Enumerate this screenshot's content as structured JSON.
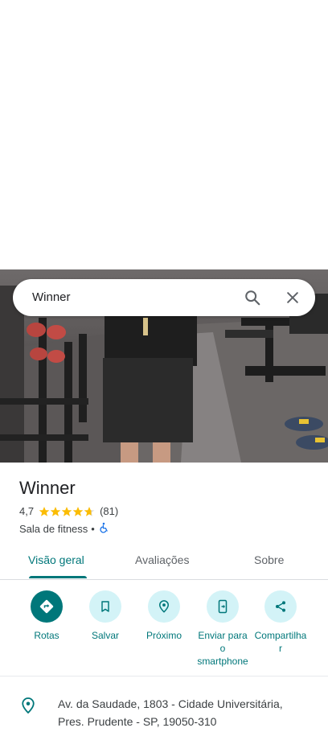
{
  "search": {
    "query": "Winner"
  },
  "place": {
    "title": "Winner",
    "rating": "4,7",
    "stars": 4.7,
    "reviews_count": "(81)",
    "category": "Sala de fitness",
    "separator": "•",
    "accessibility_icon": "wheelchair-icon"
  },
  "tabs": [
    {
      "label": "Visão geral",
      "active": true
    },
    {
      "label": "Avaliações",
      "active": false
    },
    {
      "label": "Sobre",
      "active": false
    }
  ],
  "actions": [
    {
      "label": "Rotas",
      "icon": "directions-icon"
    },
    {
      "label": "Salvar",
      "icon": "bookmark-icon"
    },
    {
      "label": "Próximo",
      "icon": "nearby-icon"
    },
    {
      "label": "Enviar para o smartphone",
      "label_lines": [
        "Enviar para",
        "o",
        "smartphone"
      ],
      "icon": "send-to-phone-icon"
    },
    {
      "label": "Compartilhar",
      "label_lines": [
        "Compartilha",
        "r"
      ],
      "icon": "share-icon"
    }
  ],
  "address": {
    "line1": "Av. da Saudade, 1803 - Cidade Universitária,",
    "line2": "Pres. Prudente - SP, 19050-310"
  },
  "colors": {
    "accent": "#00777a",
    "action_bg": "#d3f3f7",
    "star": "#fbbc04"
  }
}
